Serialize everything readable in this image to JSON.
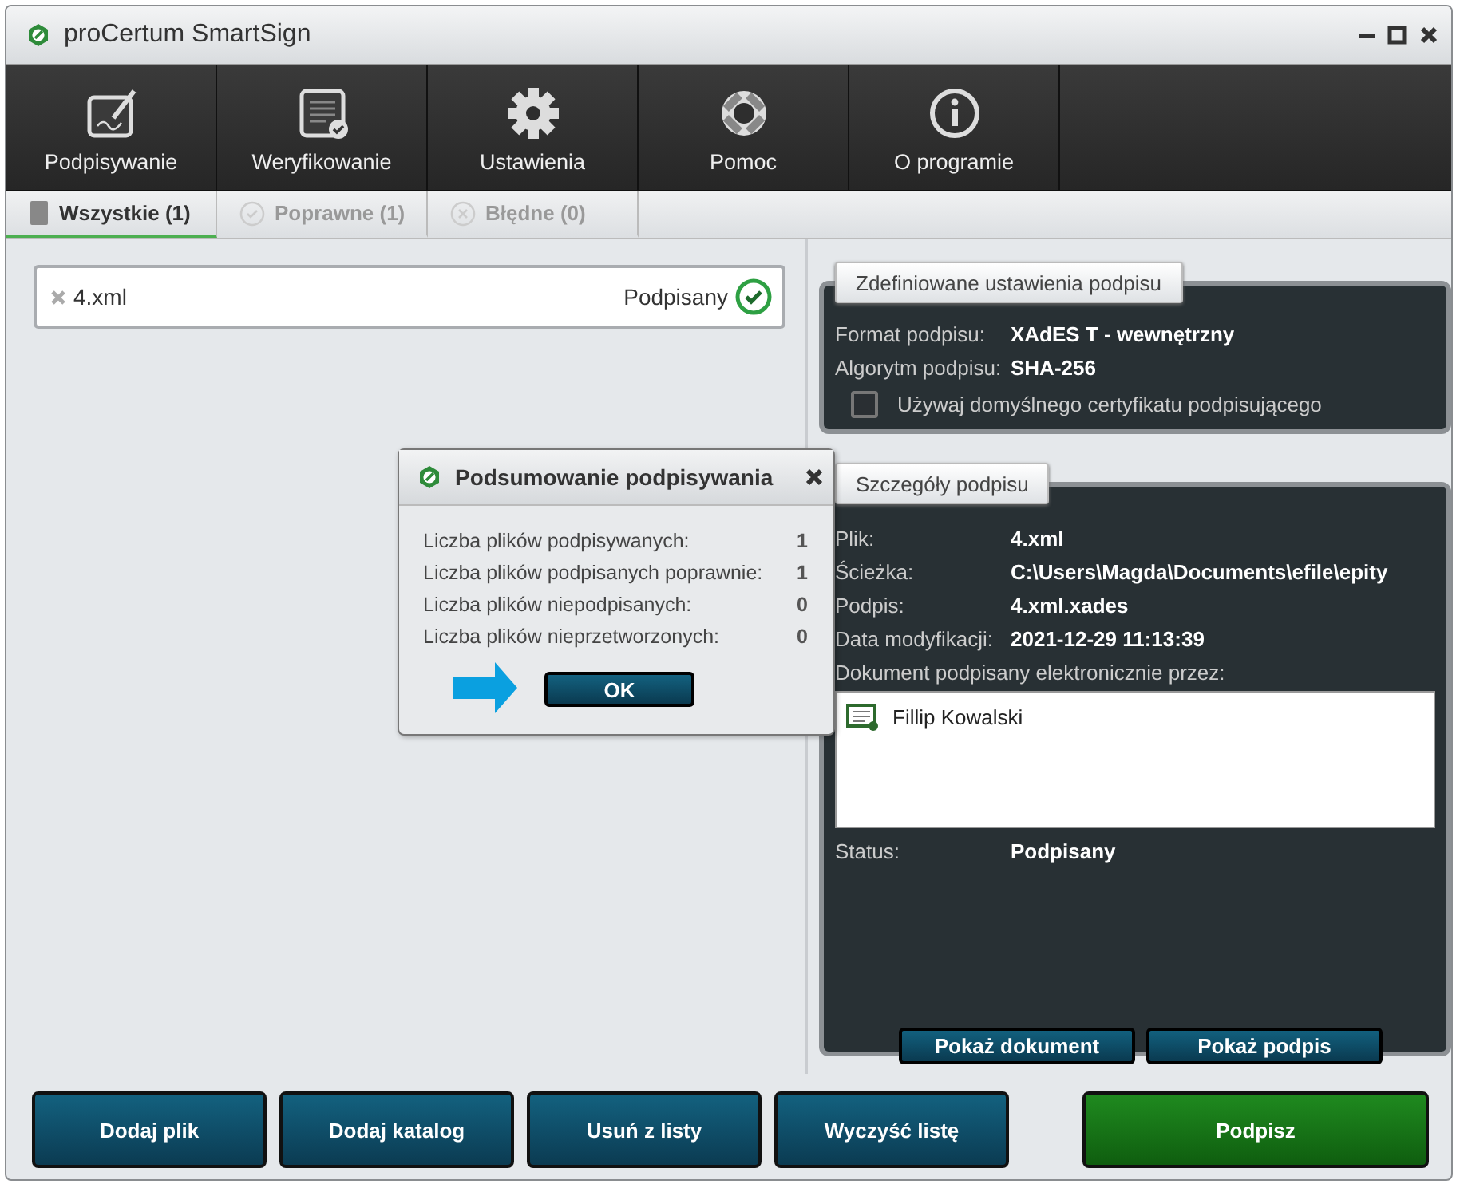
{
  "window": {
    "title": "proCertum SmartSign"
  },
  "toolbar": [
    {
      "label": "Podpisywanie",
      "kind": "sign"
    },
    {
      "label": "Weryfikowanie",
      "kind": "verify"
    },
    {
      "label": "Ustawienia",
      "kind": "settings"
    },
    {
      "label": "Pomoc",
      "kind": "help"
    },
    {
      "label": "O programie",
      "kind": "about"
    }
  ],
  "tabs": [
    {
      "label": "Wszystkie (1)",
      "kind": "all",
      "selected": true
    },
    {
      "label": "Poprawne (1)",
      "kind": "valid",
      "selected": false
    },
    {
      "label": "Błędne (0)",
      "kind": "invalid",
      "selected": false
    }
  ],
  "files": [
    {
      "name": "4.xml",
      "status": "Podpisany",
      "signed": true
    }
  ],
  "settings": {
    "title": "Zdefiniowane ustawienia podpisu",
    "rows": [
      {
        "label": "Format podpisu:",
        "value": "XAdES T - wewnętrzny"
      },
      {
        "label": "Algorytm podpisu:",
        "value": "SHA-256"
      }
    ],
    "checkbox": {
      "label": "Używaj domyślnego certyfikatu podpisującego",
      "checked": false
    }
  },
  "details": {
    "title": "Szczegóły podpisu",
    "rows": [
      {
        "label": "Plik:",
        "value": "4.xml"
      },
      {
        "label": "Ścieżka:",
        "value": "C:\\Users\\Magda\\Documents\\efile\\epity"
      },
      {
        "label": "Podpis:",
        "value": "4.xml.xades"
      },
      {
        "label": "Data modyfikacji:",
        "value": "2021-12-29 11:13:39"
      }
    ],
    "signers_label": "Dokument podpisany elektronicznie przez:",
    "signers": [
      "Fillip Kowalski"
    ],
    "status_label": "Status:",
    "status": "Podpisany",
    "buttons": [
      "Pokaż dokument",
      "Pokaż podpis"
    ]
  },
  "bottom_buttons": [
    {
      "label": "Dodaj plik",
      "kind": "normal"
    },
    {
      "label": "Dodaj katalog",
      "kind": "normal"
    },
    {
      "label": "Usuń z listy",
      "kind": "normal"
    },
    {
      "label": "Wyczyść listę",
      "kind": "normal"
    },
    {
      "label": "Podpisz",
      "kind": "primary"
    }
  ],
  "dialog": {
    "title": "Podsumowanie podpisywania",
    "rows": [
      {
        "label": "Liczba plików podpisywanych:",
        "value": "1"
      },
      {
        "label": "Liczba plików podpisanych poprawnie:",
        "value": "1"
      },
      {
        "label": "Liczba plików niepodpisanych:",
        "value": "0"
      },
      {
        "label": "Liczba plików nieprzetworzonych:",
        "value": "0"
      }
    ],
    "button": "OK"
  }
}
